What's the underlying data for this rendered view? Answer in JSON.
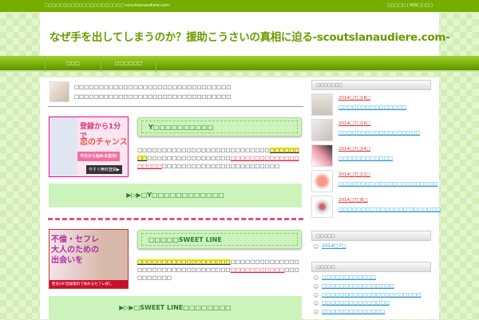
{
  "topbar": {
    "tagline": "□□□□□□□□□□□□□□□□□□□□□-scoutslanaudiere.com-",
    "links": "□□□□□ | RSS□□□□"
  },
  "header": {
    "title": "なぜ手を出してしまうのか？援助こうさいの真相に迫る-scoutslanaudiere.com-"
  },
  "nav": {
    "items": [
      "□□□",
      "□□□□□□"
    ]
  },
  "main": {
    "intro": [
      "□□□□□□□□□□□□□□□□□□□□□□□□□□□□□□□□",
      "□□□□□□□□□□□□□□□□□□□□□□□□□□□□□□□□"
    ],
    "entries": [
      {
        "ad_lines": [
          "登録から1分で",
          "恋のチャンス",
          "今日から始める恋活!"
        ],
        "ad_button": "今すぐ無料登録▶",
        "title": "Y□□□□□□□□□□",
        "desc_pre": "□□□□□□□□□□□□□□□□□□□□□□□□□□□",
        "desc_hl": "□□□□□□□□",
        "desc_mid": "□□□□□□□□□□□□□□□□□",
        "desc_red": "□□□□□□□□□□□□□□□□□□□",
        "desc_post": "□□□□□□□□□□□□□□□□□□□□□□□□",
        "cta": "▶▷▶□Y□□□□□□□□□□□□"
      },
      {
        "ad_lines": [
          "不倫・セフレ",
          "大人のための",
          "出会いを"
        ],
        "ad_button": "匿名OK!登録無料で始めるセフレ探し",
        "title": "□□□□□SWEET LINE",
        "desc_pre": "",
        "desc_hl": "□□□□□□□□□□□□□□□□□□□",
        "desc_mid": "□□□□□□□□□□□□□□□□□□□□□□□□□□□□□□□□□",
        "desc_red": "□□□□□□□□□□□",
        "desc_post": "□□□□□□□□□□",
        "cta": "▶▷▶□SWEET LINE□□□□□□□□"
      }
    ]
  },
  "sidebar": {
    "recent_heading": "□□□□□□□",
    "posts": [
      {
        "date": "2014□7□18□",
        "title": "□□□□□□□□□□□□□□□"
      },
      {
        "date": "2014□7□16□",
        "title": "□□□□□□□□□□□□□□□□□□"
      },
      {
        "date": "2014□7□14□",
        "title": "□□□□□□□□□□□□"
      },
      {
        "date": "2014□7□11□",
        "title": "□□□□□□□□□□□□□□□□□□□□□□"
      },
      {
        "date": "2014□7□6□",
        "title": "□□□□□□□□'□□□□□□□'□□□□□□□"
      }
    ],
    "archive_heading": "□□□□□",
    "archives": [
      "2014□7□"
    ],
    "category_heading": "□□□□□",
    "categories": [
      "□□□□□□□□□□□□",
      "□□□□□□□□□□□□□□□□",
      "□□□□□□□□□□□□□□□□□□□□□□",
      "□□□□□□□□□□□□□□□",
      "□□□□□□□□□□□□□□"
    ]
  }
}
